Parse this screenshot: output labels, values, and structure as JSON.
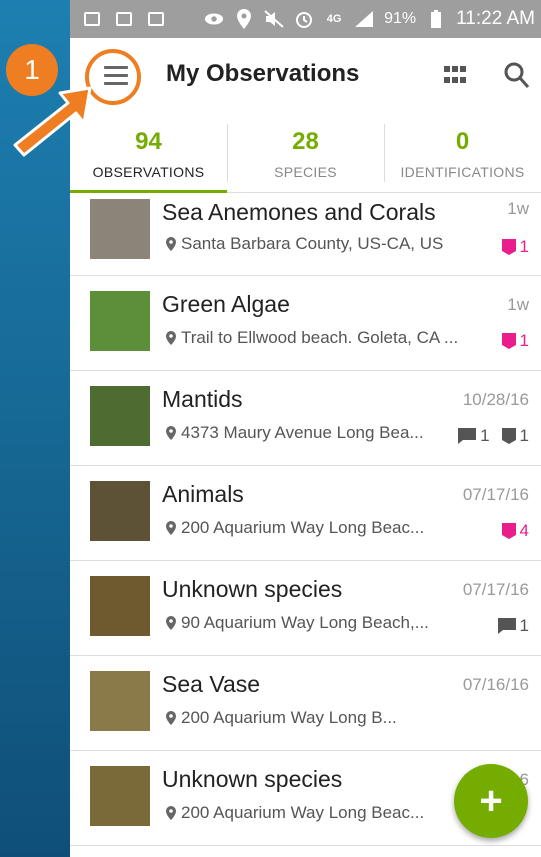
{
  "status_bar": {
    "battery": "91%",
    "time": "11:22 AM",
    "network": "4G"
  },
  "header": {
    "title": "My Observations"
  },
  "tabs": [
    {
      "count": "94",
      "label": "OBSERVATIONS"
    },
    {
      "count": "28",
      "label": "SPECIES"
    },
    {
      "count": "0",
      "label": "IDENTIFICATIONS"
    }
  ],
  "observations": [
    {
      "name": "Sea Anemones and Corals",
      "location": "Santa Barbara County, US-CA, US",
      "date": "1w",
      "favorites": "1",
      "comments": "",
      "ids": "",
      "thumb_color": "#8a8578"
    },
    {
      "name": "Green Algae",
      "location": "Trail to Ellwood beach. Goleta, CA ...",
      "date": "1w",
      "favorites": "1",
      "comments": "",
      "ids": "",
      "thumb_color": "#5d8f3a"
    },
    {
      "name": "Mantids",
      "location": "4373 Maury Avenue Long Bea...",
      "date": "10/28/16",
      "favorites": "",
      "comments": "1",
      "ids": "1",
      "thumb_color": "#4e6b32"
    },
    {
      "name": "Animals",
      "location": "200 Aquarium Way Long Beac...",
      "date": "07/17/16",
      "favorites": "4",
      "comments": "",
      "ids": "",
      "thumb_color": "#5e5236"
    },
    {
      "name": "Unknown species",
      "location": "90 Aquarium Way Long Beach,...",
      "date": "07/17/16",
      "favorites": "",
      "comments": "1",
      "ids": "",
      "thumb_color": "#6e5a2e"
    },
    {
      "name": "Sea Vase",
      "location": "200 Aquarium Way Long B...",
      "date": "07/16/16",
      "favorites": "",
      "comments": "",
      "ids": "",
      "thumb_color": "#8a7a4a"
    },
    {
      "name": "Unknown species",
      "location": "200 Aquarium Way Long Beac...",
      "date": "07/16/16",
      "favorites": "",
      "comments": "",
      "ids": "",
      "thumb_color": "#7a6a3a"
    }
  ],
  "fab": {
    "label": "+"
  },
  "annotation": {
    "step": "1"
  },
  "colors": {
    "accent": "#74ac00",
    "favorite": "#e91e8c",
    "annotation": "#ef7d22"
  }
}
